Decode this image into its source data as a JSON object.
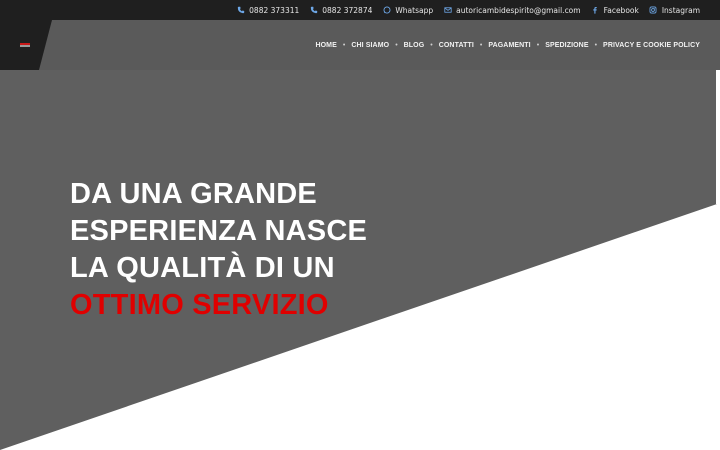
{
  "topbar": {
    "items": [
      {
        "icon": "phone-icon",
        "label": "0882 373311"
      },
      {
        "icon": "phone-icon",
        "label": "0882 372874"
      },
      {
        "icon": "whatsapp-icon",
        "label": "Whatsapp"
      },
      {
        "icon": "mail-icon",
        "label": "autoricambidespirito@gmail.com"
      },
      {
        "icon": "facebook-icon",
        "label": "Facebook"
      },
      {
        "icon": "instagram-icon",
        "label": "Instagram"
      }
    ],
    "icon_color": "#6ea8e8"
  },
  "nav": {
    "items": [
      "HOME",
      "CHI SIAMO",
      "BLOG",
      "CONTATTI",
      "PAGAMENTI",
      "SPEDIZIONE",
      "PRIVACY E COOKIE POLICY"
    ],
    "separator": "•"
  },
  "hero": {
    "lines": [
      "DA UNA GRANDE",
      "ESPERIENZA NASCE",
      "LA QUALITÀ DI UN"
    ],
    "accent_line": "OTTIMO SERVIZIO",
    "accent_color": "#e00000"
  }
}
